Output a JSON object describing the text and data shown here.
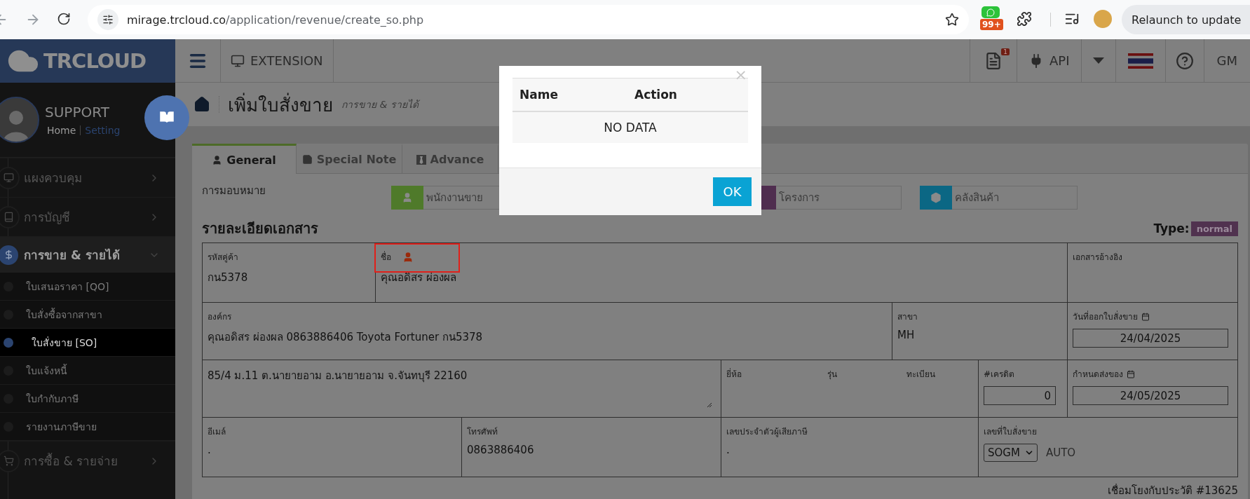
{
  "browser": {
    "url": {
      "host": "mirage.trcloud.co",
      "path": "/application/revenue/create_so.php"
    },
    "extension_badge": "99+",
    "relaunch": "Relaunch to update"
  },
  "topbar": {
    "logo": "TRCLOUD",
    "extension": "EXTENSION",
    "notification_count": "1",
    "api": "API",
    "user": "GM"
  },
  "sidebar": {
    "user": "SUPPORT",
    "home": "Home",
    "setting": "Setting",
    "items": [
      {
        "kind": "monitor",
        "label": "แผงควบคุม",
        "expanded": false
      },
      {
        "kind": "book",
        "label": "การบัญชี",
        "expanded": false
      },
      {
        "kind": "dollar",
        "label": "การขาย & รายได้",
        "expanded": true,
        "children": [
          {
            "label": "ใบเสนอราคา [QO]",
            "selected": false
          },
          {
            "label": "ใบสั่งซื้อจากสาขา",
            "selected": false
          },
          {
            "label": "ใบสั่งขาย [SO]",
            "selected": true
          },
          {
            "label": "ใบแจ้งหนี้",
            "selected": false
          },
          {
            "label": "ใบกำกับภาษี",
            "selected": false
          },
          {
            "label": "รายงานภาษีขาย",
            "selected": false
          }
        ]
      },
      {
        "kind": "cart",
        "label": "การซื้อ & รายจ่าย",
        "expanded": false
      }
    ]
  },
  "page": {
    "title": "เพิ่มใบสั่งขาย",
    "subtitle": "การขาย & รายได้"
  },
  "tabs": [
    {
      "label": "General",
      "selected": true
    },
    {
      "label": "Special Note",
      "selected": false
    },
    {
      "label": "Advance",
      "selected": false
    }
  ],
  "assignment": {
    "label": "การมอบหมาย",
    "fields": [
      {
        "placeholder": "พนักงานขาย",
        "color": "#4f7a2a"
      },
      {
        "placeholder": "โครงการ",
        "color": "#4f2d4f"
      },
      {
        "placeholder": "คลังสินค้า",
        "color": "#0b6784"
      }
    ]
  },
  "details": {
    "title": "รายละเอียดเอกสาร",
    "type_label": "Type:",
    "type_value": "normal",
    "sections": [
      {
        "fields": [
          {
            "kind": "text",
            "label": "รหัสคู่ค้า",
            "value": "กน5378"
          },
          {
            "kind": "name",
            "label": "ชื่อ",
            "value": "คุณอดิสร ผ่องผล"
          },
          {
            "kind": "text",
            "label": "เอกสารอ้างอิง"
          }
        ]
      },
      {
        "fields": [
          {
            "kind": "text",
            "label": "องค์กร",
            "value": "คุณอดิสร ผ่องผล 0863886406 Toyota Fortuner กน5378"
          },
          {
            "kind": "text",
            "label": "สาขา",
            "value": "MH"
          },
          {
            "kind": "date",
            "label": "วันที่ออกใบสั่งขาย",
            "value": "24/04/2025"
          }
        ]
      },
      {
        "fields": [
          {
            "kind": "address",
            "value": "85/4 ม.11 ต.นายายอาม อ.นายายอาม จ.จันทบุรี 22160"
          },
          {
            "kind": "vehicle",
            "labels": [
              "ยี่ห้อ",
              "รุ่น",
              "ทะเบียน"
            ]
          },
          {
            "kind": "number",
            "label": "#เครดิต",
            "value": "0"
          },
          {
            "kind": "date",
            "label": "กำหนดส่งของ",
            "value": "24/05/2025"
          }
        ]
      },
      {
        "fields": [
          {
            "kind": "text",
            "label": "อีเมล์",
            "value": "."
          },
          {
            "kind": "text",
            "label": "โทรศัพท์",
            "value": "0863886406"
          },
          {
            "kind": "text",
            "label": "เลขประจำตัวผู้เสียภาษี",
            "value": "."
          },
          {
            "kind": "select",
            "label": "เลขที่ใบสั่งขาย",
            "value": "SOGM",
            "note": "AUTO"
          }
        ]
      }
    ],
    "link": "เชื่อมโยงกับประวัติ #13625"
  },
  "modal": {
    "close": "×",
    "columns": [
      "Name",
      "Action"
    ],
    "empty": "NO DATA",
    "button": "OK"
  }
}
